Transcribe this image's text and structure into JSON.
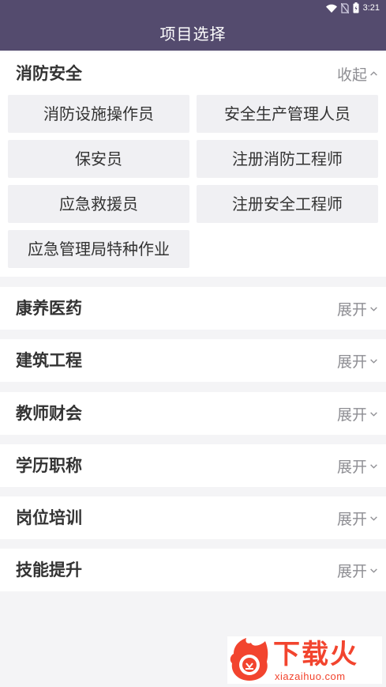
{
  "status_bar": {
    "time": "3:21"
  },
  "header": {
    "title": "项目选择"
  },
  "sections": [
    {
      "title": "消防安全",
      "toggle_label": "收起",
      "expanded": true,
      "items": [
        "消防设施操作员",
        "安全生产管理人员",
        "保安员",
        "注册消防工程师",
        "应急救援员",
        "注册安全工程师",
        "应急管理局特种作业"
      ]
    },
    {
      "title": "康养医药",
      "toggle_label": "展开",
      "expanded": false
    },
    {
      "title": "建筑工程",
      "toggle_label": "展开",
      "expanded": false
    },
    {
      "title": "教师财会",
      "toggle_label": "展开",
      "expanded": false
    },
    {
      "title": "学历职称",
      "toggle_label": "展开",
      "expanded": false
    },
    {
      "title": "岗位培训",
      "toggle_label": "展开",
      "expanded": false
    },
    {
      "title": "技能提升",
      "toggle_label": "展开",
      "expanded": false
    }
  ],
  "watermark": {
    "text": "下载火",
    "url": "xiazaihuo.com"
  },
  "colors": {
    "header_bg": "#544b6e",
    "page_bg": "#f4f4f6",
    "cell_bg": "#f0f0f3",
    "watermark": "#f2442e"
  }
}
